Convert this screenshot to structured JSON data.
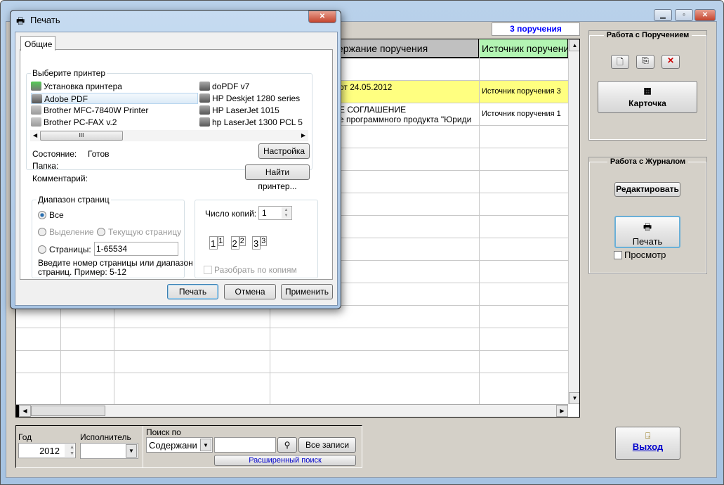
{
  "main": {
    "count_label": "3 поручения",
    "grid": {
      "headers": [
        {
          "label": "",
          "bg": "#c0c0c0"
        },
        {
          "label": "",
          "bg": "#c0c0c0"
        },
        {
          "label": "",
          "bg": "#c0c0c0"
        },
        {
          "label": "ержание поручения",
          "bg": "#c0c0c0"
        },
        {
          "label": "Источник поручения",
          "bg": "#b3f5b3"
        }
      ],
      "rows": [
        {
          "content": "",
          "source": "",
          "highlight": false
        },
        {
          "content": "от 24.05.2012",
          "source": "Источник поручения 3",
          "highlight": true
        },
        {
          "content": "Е СОГЛАШЕНИЕ",
          "content2": "е программного продукта \"Юриди",
          "source": "Источник поручения 1",
          "highlight": false
        }
      ],
      "highlight_color": "#ffff80"
    },
    "task_panel": {
      "title": "Работа с Поручением",
      "card_label": "Карточка"
    },
    "journal_panel": {
      "title": "Работа с Журналом",
      "edit_label": "Редактировать",
      "print_label": "Печать",
      "preview_label": "Просмотр"
    },
    "filters": {
      "year_label": "Год",
      "year_value": "2012",
      "executor_label": "Исполнитель",
      "search_label": "Поиск по",
      "search_field": "Содержани",
      "all_records": "Все записи",
      "advanced_search": "Расширенный поиск"
    },
    "exit_label": "Выход"
  },
  "dialog": {
    "title": "Печать",
    "tab": "Общие",
    "printer_group": "Выберите принтер",
    "printers": [
      "Установка принтера",
      "Adobe PDF",
      "Brother MFC-7840W Printer",
      "Brother PC-FAX v.2",
      "doPDF v7",
      "HP Deskjet 1280 series",
      "HP LaserJet 1015",
      "hp LaserJet 1300 PCL 5"
    ],
    "status_label": "Состояние:",
    "status_value": "Готов",
    "folder_label": "Папка:",
    "comment_label": "Комментарий:",
    "settings_btn": "Настройка",
    "find_btn": "Найти принтер...",
    "range_group": "Диапазон страниц",
    "all": "Все",
    "selection": "Выделение",
    "current": "Текущую страницу",
    "pages": "Страницы:",
    "pages_value": "1-65534",
    "hint": "Введите номер страницы или диапазон",
    "hint2": "страниц.  Пример: 5-12",
    "copies_label": "Число копий:",
    "copies_value": "1",
    "collate": "Разобрать по копиям",
    "print_btn": "Печать",
    "cancel_btn": "Отмена",
    "apply_btn": "Применить"
  }
}
